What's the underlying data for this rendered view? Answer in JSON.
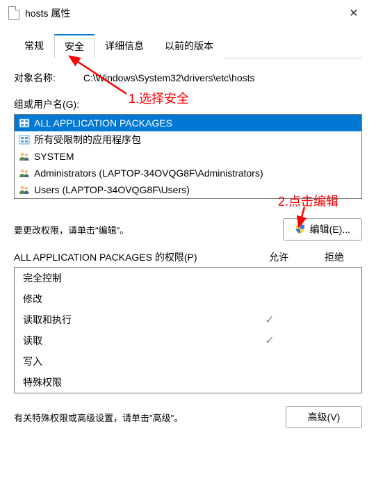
{
  "window": {
    "title": "hosts 属性",
    "close": "✕"
  },
  "tabs": [
    {
      "label": "常规"
    },
    {
      "label": "安全"
    },
    {
      "label": "详细信息"
    },
    {
      "label": "以前的版本"
    }
  ],
  "object": {
    "label": "对象名称:",
    "path": "C:\\Windows\\System32\\drivers\\etc\\hosts"
  },
  "groups": {
    "label": "组或用户名(G):",
    "items": [
      {
        "icon": "pkg",
        "text": "ALL APPLICATION PACKAGES",
        "selected": true
      },
      {
        "icon": "pkg",
        "text": "所有受限制的应用程序包",
        "selected": false
      },
      {
        "icon": "users",
        "text": "SYSTEM",
        "selected": false
      },
      {
        "icon": "users",
        "text": "Administrators (LAPTOP-34OVQG8F\\Administrators)",
        "selected": false
      },
      {
        "icon": "users",
        "text": "Users (LAPTOP-34OVQG8F\\Users)",
        "selected": false
      }
    ]
  },
  "editRow": {
    "text": "要更改权限，请单击\"编辑\"。",
    "button": "编辑(E)..."
  },
  "permissions": {
    "headerName": "ALL APPLICATION PACKAGES 的权限(P)",
    "allow": "允许",
    "deny": "拒绝",
    "rows": [
      {
        "name": "完全控制",
        "allow": false,
        "deny": false
      },
      {
        "name": "修改",
        "allow": false,
        "deny": false
      },
      {
        "name": "读取和执行",
        "allow": true,
        "deny": false
      },
      {
        "name": "读取",
        "allow": true,
        "deny": false
      },
      {
        "name": "写入",
        "allow": false,
        "deny": false
      },
      {
        "name": "特殊权限",
        "allow": false,
        "deny": false
      }
    ]
  },
  "advanced": {
    "text": "有关特殊权限或高级设置，请单击\"高级\"。",
    "button": "高级(V)"
  },
  "annotations": {
    "a1": "1.选择安全",
    "a2": "2.点击编辑"
  }
}
